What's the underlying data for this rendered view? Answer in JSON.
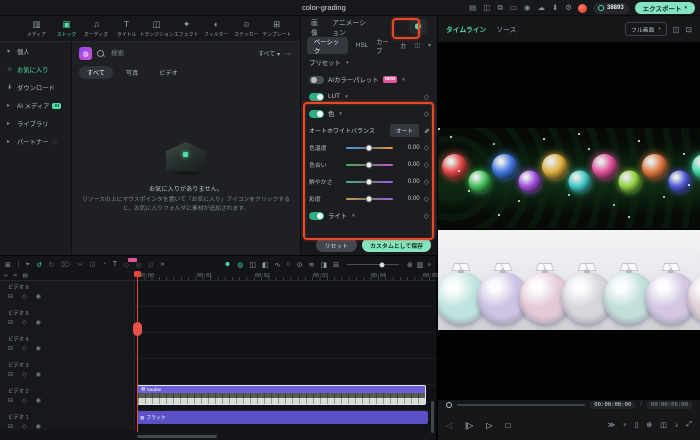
{
  "titlebar": {
    "title": "color-grading",
    "coin_count": "38893",
    "export_label": "エクスポート",
    "accent_green": "#85e5c0",
    "icons": [
      {
        "name": "store-icon",
        "glyph": "▤"
      },
      {
        "name": "share-icon",
        "glyph": "◫"
      },
      {
        "name": "screen-record-icon",
        "glyph": "⧉"
      },
      {
        "name": "display-icon",
        "glyph": "▭"
      },
      {
        "name": "snapshot-icon",
        "glyph": "◉"
      },
      {
        "name": "cloud-icon",
        "glyph": "☁"
      },
      {
        "name": "download-icon",
        "glyph": "⬇"
      },
      {
        "name": "settings-icon",
        "glyph": "⚙"
      }
    ]
  },
  "source_nav": {
    "items": [
      {
        "name": "nav-media",
        "label": "メディア",
        "glyph": "▥"
      },
      {
        "name": "nav-stock",
        "label": "ストック",
        "glyph": "▣",
        "active": true
      },
      {
        "name": "nav-audio",
        "label": "オーディオ",
        "glyph": "♫"
      },
      {
        "name": "nav-title",
        "label": "タイトル",
        "glyph": "T"
      },
      {
        "name": "nav-transition",
        "label": "トランジション",
        "glyph": "◫"
      },
      {
        "name": "nav-effect",
        "label": "エフェクト",
        "glyph": "✦"
      },
      {
        "name": "nav-filter",
        "label": "フィルター",
        "glyph": "◐"
      },
      {
        "name": "nav-sticker",
        "label": "ステッカー",
        "glyph": "☺"
      },
      {
        "name": "nav-template",
        "label": "テンプレート",
        "glyph": "⊞"
      }
    ]
  },
  "sidebar": {
    "items": [
      {
        "label": "個人"
      },
      {
        "label": "お気に入り"
      },
      {
        "label": "ダウンロード"
      },
      {
        "label": "AI メディア",
        "badge": "AI"
      },
      {
        "label": "ライブラリ"
      },
      {
        "label": "パートナー"
      }
    ]
  },
  "media_panel": {
    "search_placeholder": "検索",
    "scope_label": "すべて ▾",
    "more_label": "⋯",
    "tabs": [
      "すべて",
      "写真",
      "ビデオ"
    ],
    "empty_title": "お気に入りがありません。",
    "empty_body": "リソースの上にマウスポインタを置いて「お気に入り」アイコンをクリックすると、お気に入りフォルダに素材が追加されます。"
  },
  "properties": {
    "accent": "#52e0a8",
    "tabs": [
      "画像",
      "アニメーション"
    ],
    "subtabs": [
      "ベーシック",
      "HSL",
      "カーブ",
      "カ"
    ],
    "preset_label": "プリセット",
    "ai_palette_label": "AIカラーパレット",
    "new_badge": "NEW",
    "lut_label": "LUT",
    "color_label": "色",
    "awb_label": "オートホワイトバランス",
    "auto_button": "オート",
    "sliders": [
      {
        "label": "色温度",
        "value": "0.00",
        "colors": [
          "#3f9df0",
          "#777777",
          "#ef9440"
        ]
      },
      {
        "label": "色合い",
        "value": "0.00",
        "colors": [
          "#43b45e",
          "#777777",
          "#cf54d8"
        ]
      },
      {
        "label": "鮮やかさ",
        "value": "0.00",
        "colors": [
          "#3fb490",
          "#777777",
          "#9a5ceb"
        ]
      },
      {
        "label": "彩度",
        "value": "0.00",
        "colors": [
          "#d29a45",
          "#777777",
          "#b05ce0"
        ]
      }
    ],
    "light_label": "ライト",
    "reset_label": "リセット",
    "save_label": "カスタムとして保存"
  },
  "preview": {
    "tabs": [
      "タイムライン",
      "ソース"
    ],
    "display_mode": "フル画面",
    "display_caret": "▾",
    "header_icons": [
      {
        "name": "compare-view-icon",
        "glyph": "◫"
      },
      {
        "name": "pip-view-icon",
        "glyph": "⊡"
      }
    ],
    "current_time": "00:00:00:00",
    "time_separator": "/",
    "total_time": "00:00:06:00",
    "controls_left": [
      {
        "name": "step-back-button",
        "glyph": "◁",
        "dim": true
      },
      {
        "name": "step-forward-button",
        "glyph": "|▷"
      },
      {
        "name": "play-button",
        "glyph": "▷"
      },
      {
        "name": "stop-button",
        "glyph": "□"
      }
    ],
    "controls_right": [
      {
        "name": "render-preview-button",
        "glyph": "≫"
      },
      {
        "name": "render-caret-icon",
        "glyph": "▾",
        "dim": true
      },
      {
        "name": "device-preview-icon",
        "glyph": "▯"
      },
      {
        "name": "zoom-level-icon",
        "glyph": "⊕"
      },
      {
        "name": "snapshot-icon",
        "glyph": "◫"
      },
      {
        "name": "volume-icon",
        "glyph": "♪"
      },
      {
        "name": "fullscreen-icon",
        "glyph": "⤢"
      }
    ],
    "ornaments_top": [
      "#e04545",
      "#44c05a",
      "#4076e0",
      "#a44fe0",
      "#e0b040",
      "#40c8c8",
      "#e04f9a",
      "#90d040",
      "#e07840",
      "#5058d8",
      "#48d8a8",
      "#c84060"
    ],
    "ornaments_bottom": [
      "#bfe4df",
      "#cdc3e4",
      "#e4cad8",
      "#d6d6dc",
      "#c3dfdb",
      "#d3c7e2",
      "#e0d0d8"
    ]
  },
  "timeline": {
    "toolbar_left": [
      {
        "name": "media-manager-icon",
        "glyph": "⊞"
      },
      {
        "name": "toolbar-divider",
        "glyph": "|",
        "i": "false",
        "dim": true
      },
      {
        "name": "select-tool-icon",
        "glyph": "⌖"
      },
      {
        "name": "undo-icon",
        "glyph": "↺",
        "color": "#52e0a8"
      },
      {
        "name": "redo-icon",
        "glyph": "↻",
        "dim": true
      },
      {
        "name": "delete-icon",
        "glyph": "⌦",
        "dim": true
      },
      {
        "name": "split-icon",
        "glyph": "✂",
        "dim": true
      },
      {
        "name": "crop-icon",
        "glyph": "⊡",
        "dim": true
      },
      {
        "name": "speed-icon",
        "glyph": "◔",
        "dim": true
      },
      {
        "name": "text-tool-icon",
        "glyph": "T"
      },
      {
        "name": "keyframe-icon",
        "glyph": "◇",
        "dim": true
      },
      {
        "name": "mask-icon",
        "glyph": "◎",
        "dim": true
      },
      {
        "name": "motion-track-icon",
        "glyph": "⊙",
        "dim": true
      },
      {
        "name": "more-tools-icon",
        "glyph": "»"
      }
    ],
    "toolbar_right": [
      {
        "name": "marker-icon",
        "glyph": "☻",
        "color": "#52e0a8"
      },
      {
        "name": "quick-split-icon",
        "glyph": "◍",
        "color": "#3fd0b8"
      },
      {
        "name": "compound-clip-icon",
        "glyph": "◫"
      },
      {
        "name": "group-icon",
        "glyph": "◧"
      },
      {
        "name": "audio-stretch-icon",
        "glyph": "∿"
      },
      {
        "name": "keyframe-circle-icon",
        "glyph": "○"
      },
      {
        "name": "record-voiceover-icon",
        "glyph": "⊙"
      },
      {
        "name": "audio-mixer-icon",
        "glyph": "≋"
      },
      {
        "name": "snapshot-clip-icon",
        "glyph": "◨"
      },
      {
        "name": "marker-flag-icon",
        "glyph": "⊟"
      }
    ],
    "toolbar_right2": [
      {
        "name": "fit-timeline-icon",
        "glyph": "⊛"
      },
      {
        "name": "track-height-icon",
        "glyph": "▥"
      },
      {
        "name": "track-height-caret",
        "glyph": "▾",
        "dim": true
      }
    ],
    "ruler_icons": [
      {
        "name": "link-clips-icon",
        "glyph": "∞"
      },
      {
        "name": "snap-icon",
        "glyph": "≍"
      },
      {
        "name": "ripple-edit-icon",
        "glyph": "▤"
      }
    ],
    "ruler_ticks": [
      "00:00",
      "00:01",
      "00:02",
      "00:03",
      "00:04",
      "00:05"
    ],
    "tracks": [
      "ビデオ 6",
      "ビデオ 5",
      "ビデオ 4",
      "ビデオ 3",
      "ビデオ 2",
      "ビデオ 1"
    ],
    "track_icons": [
      {
        "name": "lock-track-icon",
        "glyph": "⊟"
      },
      {
        "name": "hide-track-icon",
        "glyph": "◇"
      },
      {
        "name": "mute-track-icon",
        "glyph": "◉"
      }
    ],
    "clips": [
      {
        "label": "bauble"
      },
      {
        "label": "ブラック"
      }
    ],
    "clip_color": "#5b50c8"
  }
}
